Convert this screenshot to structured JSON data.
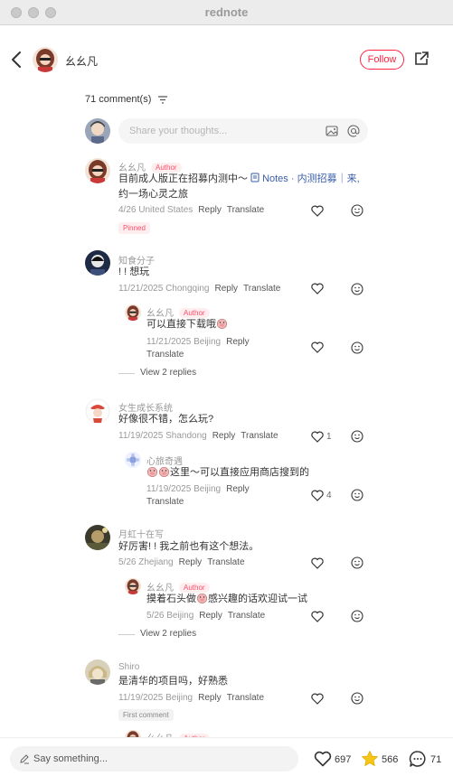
{
  "window": {
    "title": "rednote"
  },
  "header": {
    "author_name": "幺幺凡",
    "follow_label": "Follow"
  },
  "comments_header": {
    "count_label": "71 comment(s)"
  },
  "composer": {
    "placeholder": "Share your thoughts..."
  },
  "labels": {
    "reply": "Reply",
    "translate": "Translate",
    "author_tag": "Author",
    "pinned": "Pinned",
    "first_comment": "First comment"
  },
  "comments": [
    {
      "name": "幺幺凡",
      "text_before_link": "目前成人版正在招募内测中～ ",
      "link_text": "Notes · 内测招募｜来,",
      "text_line2": "约一场心灵之旅",
      "date": "4/26 United States",
      "pinned": true
    },
    {
      "name": "知食分子",
      "text": "! ! 想玩",
      "date": "11/21/2025 Chongqing",
      "reply": {
        "name": "幺幺凡",
        "text": "可以直接下载哦",
        "date": "11/21/2025 Beijing"
      },
      "view_replies": "View 2 replies"
    },
    {
      "name": "女生成长系统",
      "text": "好像很不错，怎么玩?",
      "date": "11/19/2025 Shandong",
      "likes": "1",
      "reply": {
        "name": "心旅奇遇",
        "text": "这里～可以直接应用商店搜到的",
        "date": "11/19/2025 Beijing",
        "likes": "4"
      }
    },
    {
      "name": "月虹十在写",
      "text": "好厉害! !   我之前也有这个想法。",
      "date": "5/26 Zhejiang",
      "reply": {
        "name": "幺幺凡",
        "text_before": "摸着石头做",
        "text_after": "感兴趣的话欢迎试一试",
        "date": "5/26 Beijing"
      },
      "view_replies": "View 2 replies"
    },
    {
      "name": "Shiro",
      "text": "是清华的项目吗，好熟悉",
      "date": "11/19/2025 Beijing",
      "first_comment": true,
      "reply_peek": {
        "name": "幺幺凡"
      }
    }
  ],
  "bottom_bar": {
    "say_placeholder": "Say something...",
    "likes": "697",
    "collects": "566",
    "comments": "71"
  },
  "colors": {
    "accent": "#ff2442",
    "author_tag_bg": "#ffeef0",
    "link": "#3a5ea9",
    "star": "#f5c518"
  }
}
